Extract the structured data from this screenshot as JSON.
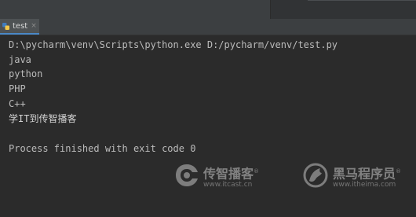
{
  "tab": {
    "label": "test",
    "close": "×"
  },
  "console": {
    "lines": [
      "D:\\pycharm\\venv\\Scripts\\python.exe D:/pycharm/venv/test.py",
      "java",
      "python",
      "PHP",
      "C++",
      "学IT到传智播客",
      "",
      "Process finished with exit code 0"
    ]
  },
  "watermarks": {
    "left": {
      "name": "传智播客",
      "url": "www.itcast.cn",
      "icon": "itcast-logo-icon"
    },
    "right": {
      "name": "黑马程序员",
      "url": "www.itheima.com",
      "icon": "itheima-horse-logo-icon"
    },
    "registered_mark": "®"
  },
  "colors": {
    "background": "#2b2b2b",
    "text": "#bbbbbb",
    "tab_accent": "#4a88c7",
    "python_icon_blue": "#3f7cc0",
    "python_icon_yellow": "#f3c84a"
  }
}
